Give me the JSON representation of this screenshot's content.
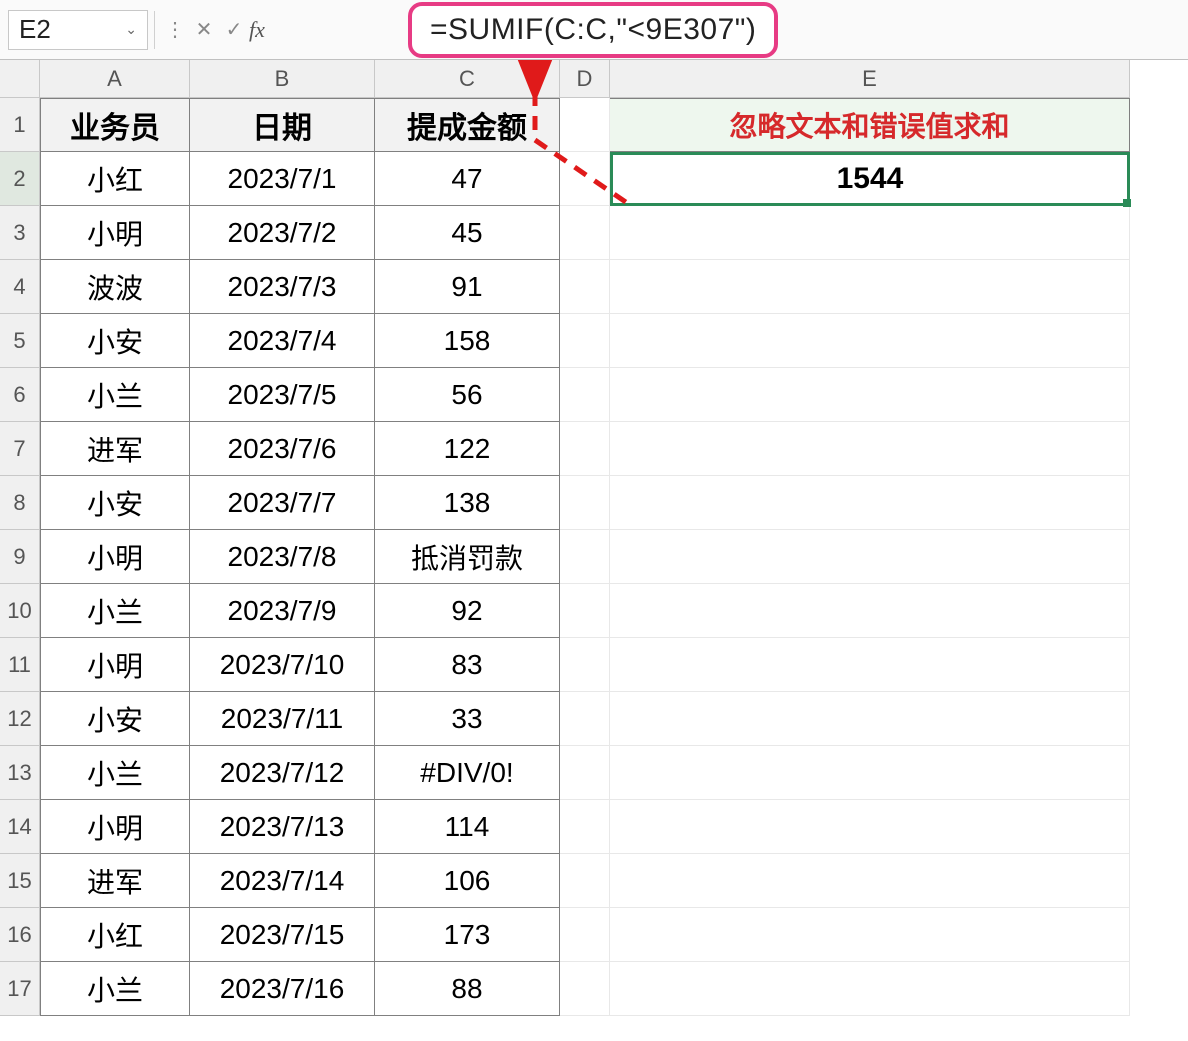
{
  "formula_bar": {
    "cell_ref": "E2",
    "fx_label": "fx",
    "formula": "=SUMIF(C:C,\"<9E307\")"
  },
  "columns": [
    "A",
    "B",
    "C",
    "D",
    "E"
  ],
  "row_numbers": [
    1,
    2,
    3,
    4,
    5,
    6,
    7,
    8,
    9,
    10,
    11,
    12,
    13,
    14,
    15,
    16,
    17
  ],
  "headers": {
    "A": "业务员",
    "B": "日期",
    "C": "提成金额",
    "E": "忽略文本和错误值求和"
  },
  "result": {
    "E2": "1544"
  },
  "rows": [
    {
      "A": "小红",
      "B": "2023/7/1",
      "C": "47"
    },
    {
      "A": "小明",
      "B": "2023/7/2",
      "C": "45"
    },
    {
      "A": "波波",
      "B": "2023/7/3",
      "C": "91"
    },
    {
      "A": "小安",
      "B": "2023/7/4",
      "C": "158"
    },
    {
      "A": "小兰",
      "B": "2023/7/5",
      "C": "56"
    },
    {
      "A": "进军",
      "B": "2023/7/6",
      "C": "122"
    },
    {
      "A": "小安",
      "B": "2023/7/7",
      "C": "138"
    },
    {
      "A": "小明",
      "B": "2023/7/8",
      "C": "抵消罚款"
    },
    {
      "A": "小兰",
      "B": "2023/7/9",
      "C": "92"
    },
    {
      "A": "小明",
      "B": "2023/7/10",
      "C": "83"
    },
    {
      "A": "小安",
      "B": "2023/7/11",
      "C": "33"
    },
    {
      "A": "小兰",
      "B": "2023/7/12",
      "C": "#DIV/0!"
    },
    {
      "A": "小明",
      "B": "2023/7/13",
      "C": "114"
    },
    {
      "A": "进军",
      "B": "2023/7/14",
      "C": "106"
    },
    {
      "A": "小红",
      "B": "2023/7/15",
      "C": "173"
    },
    {
      "A": "小兰",
      "B": "2023/7/16",
      "C": "88"
    }
  ]
}
